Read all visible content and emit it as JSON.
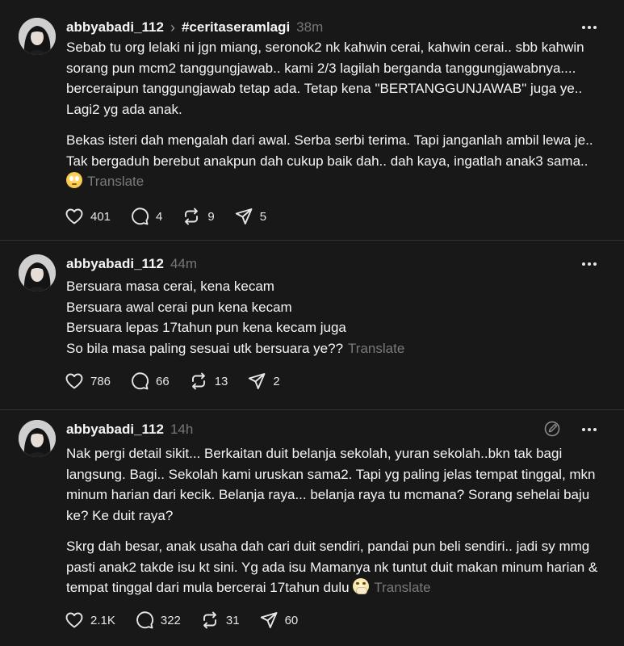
{
  "posts": [
    {
      "username": "abbyabadi_112",
      "community": "#ceritaseramlagi",
      "time": "38m",
      "paragraphs": [
        "Sebab tu org lelaki ni jgn miang, seronok2 nk kahwin cerai, kahwin cerai.. sbb kahwin sorang pun mcm2 tanggungjawab.. kami 2/3 lagilah berganda tanggungjawabnya.... berceraipun tanggungjawab tetap ada. Tetap kena \"BERTANGGUNJAWAB\" juga ye.. Lagi2 yg ada anak.",
        "Bekas isteri dah mengalah dari awal. Serba serbi terima. Tapi janganlah ambil lewa je.. Tak bergaduh berebut anakpun dah cukup baik dah.. dah kaya, ingatlah anak3 sama.."
      ],
      "emoji": "face-with-rolling-eyes",
      "translate": "Translate",
      "likes": "401",
      "replies": "4",
      "reposts": "9",
      "shares": "5"
    },
    {
      "username": "abbyabadi_112",
      "time": "44m",
      "lines": [
        "Bersuara masa cerai, kena kecam",
        "Bersuara awal cerai pun kena kecam",
        "Bersuara lepas 17tahun pun kena kecam juga",
        "So bila masa paling sesuai utk bersuara ye??"
      ],
      "translate": "Translate",
      "likes": "786",
      "replies": "66",
      "reposts": "13",
      "shares": "2"
    },
    {
      "username": "abbyabadi_112",
      "time": "14h",
      "paragraphs": [
        "Nak pergi detail sikit... Berkaitan duit belanja sekolah, yuran sekolah..bkn tak bagi langsung. Bagi.. Sekolah kami uruskan sama2. Tapi yg paling jelas tempat tinggal, mkn minum harian dari kecik. Belanja raya... belanja raya tu mcmana? Sorang sehelai baju ke? Ke duit raya?",
        "Skrg dah besar, anak usaha dah cari duit sendiri, pandai pun beli sendiri.. jadi sy mmg pasti anak2 takde isu kt sini. Yg ada isu Mamanya nk tuntut duit makan minum harian & tempat tinggal dari mula bercerai 17tahun dulu"
      ],
      "emoji": "face-with-hand-over-mouth",
      "translate": "Translate",
      "likes": "2.1K",
      "replies": "322",
      "reposts": "31",
      "shares": "60"
    }
  ],
  "colors": {
    "background": "#181818",
    "text": "#f3f5f7",
    "muted": "#777777",
    "divider": "#333333"
  },
  "icons": [
    "heart-icon",
    "comment-icon",
    "repost-icon",
    "share-icon",
    "more-icon",
    "edit-icon"
  ]
}
